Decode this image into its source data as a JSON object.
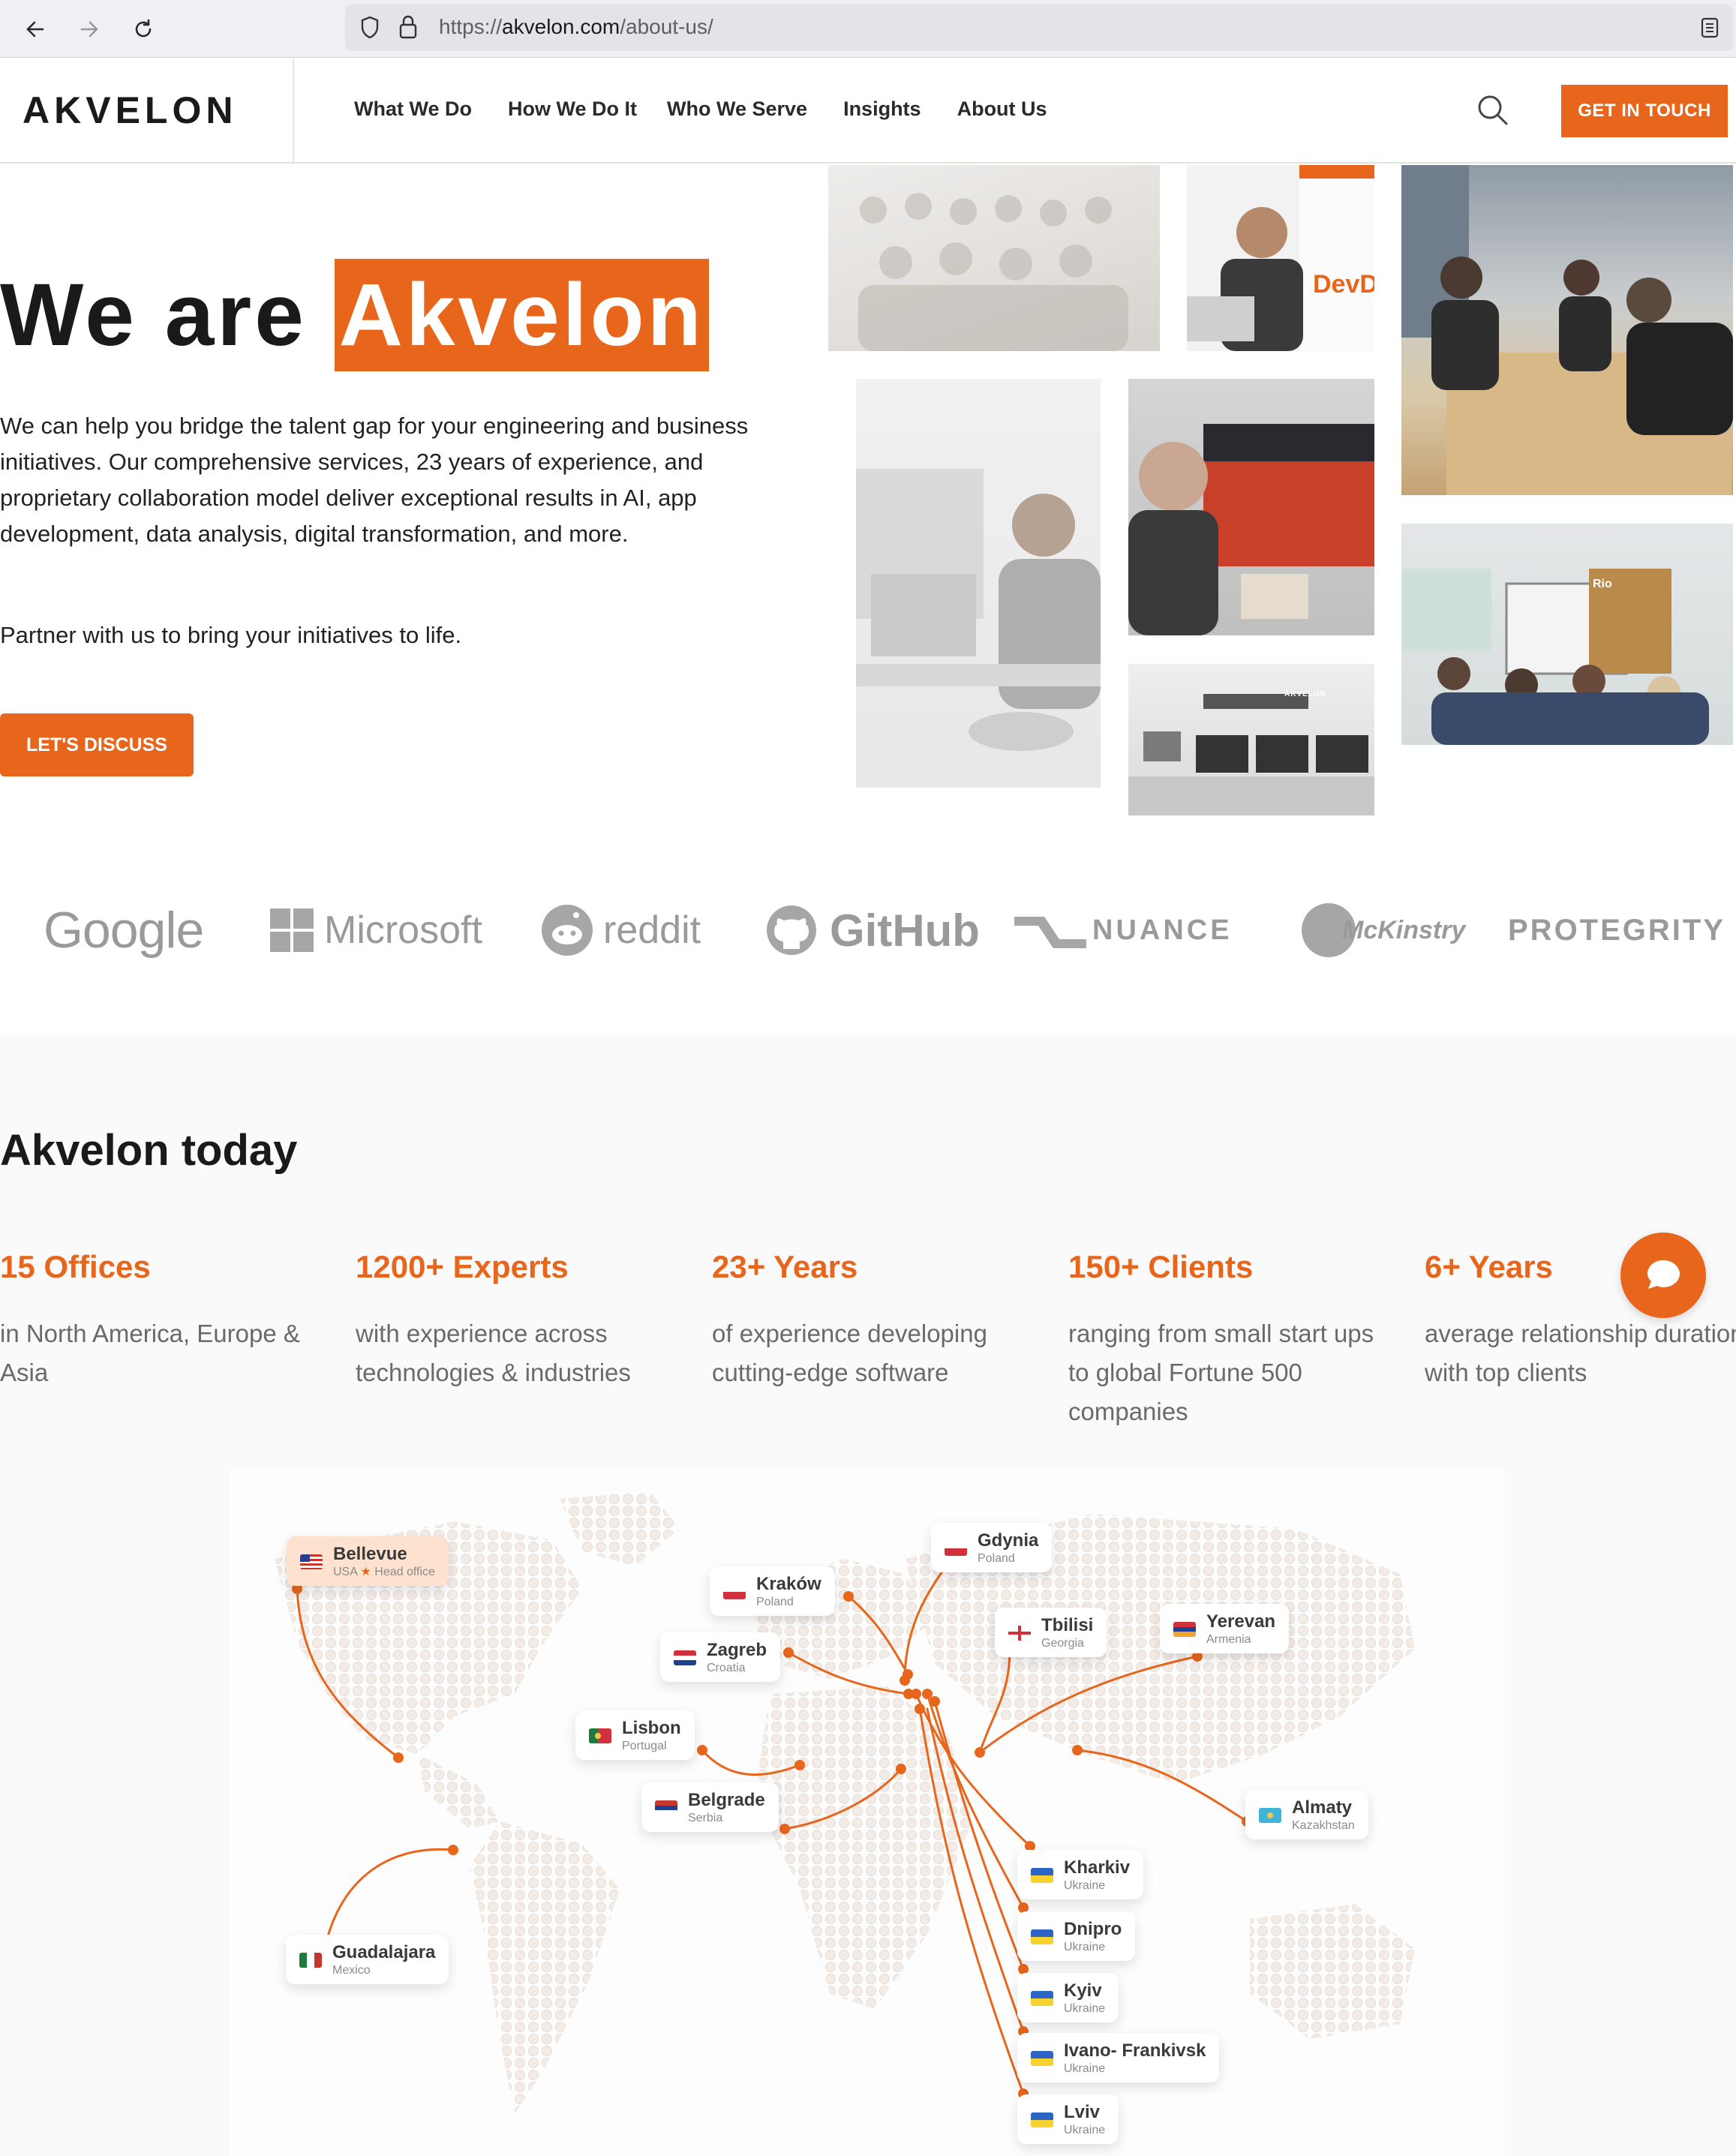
{
  "browser": {
    "url_prefix": "https://",
    "url_domain": "akvelon.com",
    "url_path": "/about-us/"
  },
  "header": {
    "logo": "AKVELON",
    "menu": [
      "What We Do",
      "How We Do It",
      "Who We Serve",
      "Insights",
      "About Us"
    ],
    "cta": "GET IN TOUCH"
  },
  "hero": {
    "title_prefix": "We are",
    "title_highlight": "Akvelon",
    "paragraph1": "We can help you bridge the talent gap for your engineering and business initiatives. Our comprehensive services, 23 years of experience, and proprietary collaboration model deliver exceptional results in AI, app development, data analysis, digital transformation, and more.",
    "paragraph2": "Partner with us to bring your initiatives to life.",
    "cta": "LET'S DISCUSS"
  },
  "photo_signs": {
    "devday": "DevDay",
    "akvelon": "AKVELON",
    "rio": "Rio"
  },
  "clients": [
    "Google",
    "Microsoft",
    "reddit",
    "GitHub",
    "NUANCE",
    "McKinstry",
    "PROTEGRITY"
  ],
  "today": {
    "title": "Akvelon today",
    "stats": [
      {
        "value": "15 Offices",
        "desc": "in North America, Europe & Asia"
      },
      {
        "value": "1200+ Experts",
        "desc": "with experience across technologies & industries"
      },
      {
        "value": "23+ Years",
        "desc": "of experience developing cutting-edge software"
      },
      {
        "value": "150+ Clients",
        "desc": "ranging from small start ups to global Fortune 500 companies"
      },
      {
        "value": "6+ Years",
        "desc": "average relationship duration with top clients"
      }
    ]
  },
  "map": {
    "accent": "#e8661c",
    "offices": [
      {
        "name": "Bellevue",
        "country": "USA",
        "note": "Head office"
      },
      {
        "name": "Guadalajara",
        "country": "Mexico"
      },
      {
        "name": "Kraków",
        "country": "Poland"
      },
      {
        "name": "Gdynia",
        "country": "Poland"
      },
      {
        "name": "Zagreb",
        "country": "Croatia"
      },
      {
        "name": "Lisbon",
        "country": "Portugal"
      },
      {
        "name": "Belgrade",
        "country": "Serbia"
      },
      {
        "name": "Tbilisi",
        "country": "Georgia"
      },
      {
        "name": "Yerevan",
        "country": "Armenia"
      },
      {
        "name": "Almaty",
        "country": "Kazakhstan"
      },
      {
        "name": "Kharkiv",
        "country": "Ukraine"
      },
      {
        "name": "Dnipro",
        "country": "Ukraine"
      },
      {
        "name": "Kyiv",
        "country": "Ukraine"
      },
      {
        "name": "Ivano- Frankivsk",
        "country": "Ukraine"
      },
      {
        "name": "Lviv",
        "country": "Ukraine"
      }
    ]
  }
}
